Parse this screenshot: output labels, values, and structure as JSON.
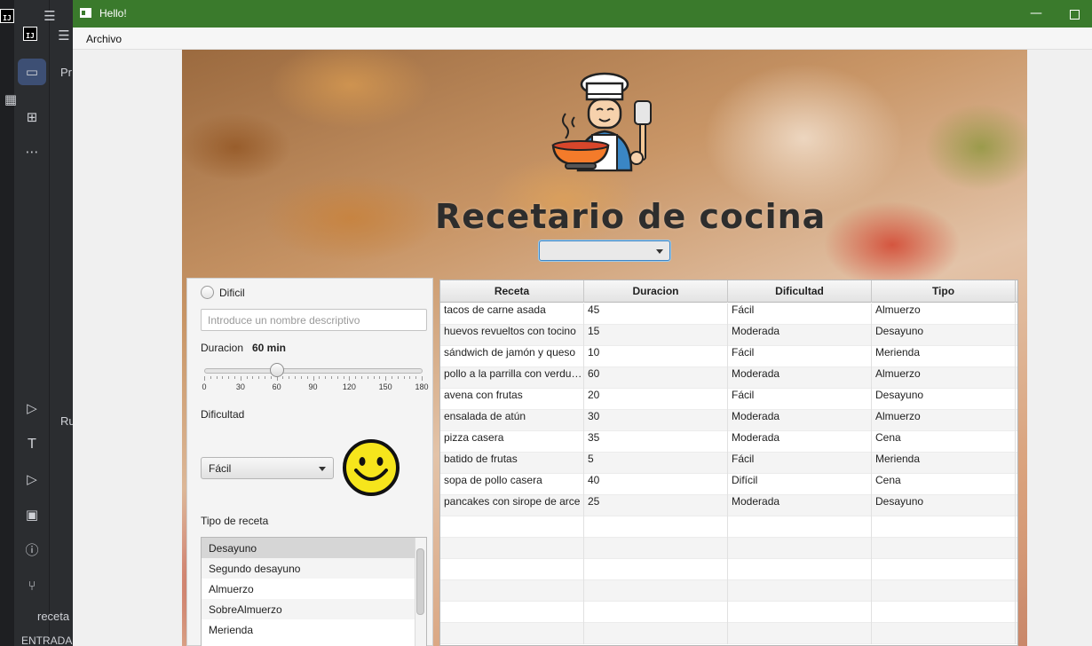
{
  "ide": {
    "side_labels": [
      "Pr",
      "Ru"
    ],
    "bottom_text_1": "receta",
    "bottom_text_2": "ENTRADA"
  },
  "window": {
    "title": "Hello!"
  },
  "menubar": {
    "items": [
      "Archivo"
    ]
  },
  "header": {
    "title": "Recetario de cocina",
    "top_combo_value": ""
  },
  "filters": {
    "radio_label": "Dificil",
    "name_placeholder": "Introduce un nombre descriptivo",
    "duration_label": "Duracion",
    "duration_value": "60 min",
    "slider": {
      "min": 0,
      "max": 180,
      "value": 60,
      "tick_labels": [
        "0",
        "30",
        "60",
        "90",
        "120",
        "150",
        "180"
      ]
    },
    "difficulty_label": "Dificultad",
    "difficulty_value": "Fácil",
    "type_label": "Tipo de receta",
    "type_options": [
      "Desayuno",
      "Segundo desayuno",
      "Almuerzo",
      "SobreAlmuerzo",
      "Merienda"
    ],
    "type_selected": "Desayuno"
  },
  "table": {
    "columns": [
      "Receta",
      "Duracion",
      "Dificultad",
      "Tipo"
    ],
    "rows": [
      [
        "tacos de carne asada",
        "45",
        "Fácil",
        "Almuerzo"
      ],
      [
        "huevos revueltos con tocino",
        "15",
        "Moderada",
        "Desayuno"
      ],
      [
        "sándwich de jamón y queso",
        "10",
        "Fácil",
        "Merienda"
      ],
      [
        "pollo a la parrilla con verduras",
        "60",
        "Moderada",
        "Almuerzo"
      ],
      [
        "avena con frutas",
        "20",
        "Fácil",
        "Desayuno"
      ],
      [
        "ensalada de atún",
        "30",
        "Moderada",
        "Almuerzo"
      ],
      [
        "pizza casera",
        "35",
        "Moderada",
        "Cena"
      ],
      [
        "batido de frutas",
        "5",
        "Fácil",
        "Merienda"
      ],
      [
        "sopa de pollo casera",
        "40",
        "Difícil",
        "Cena"
      ],
      [
        "pancakes con sirope de arce",
        "25",
        "Moderada",
        "Desayuno"
      ]
    ],
    "empty_rows": 6
  },
  "colors": {
    "titlebar": "#3a7a2c",
    "accent_focus": "#3e86c6",
    "smiley_yellow": "#f6e51c"
  }
}
